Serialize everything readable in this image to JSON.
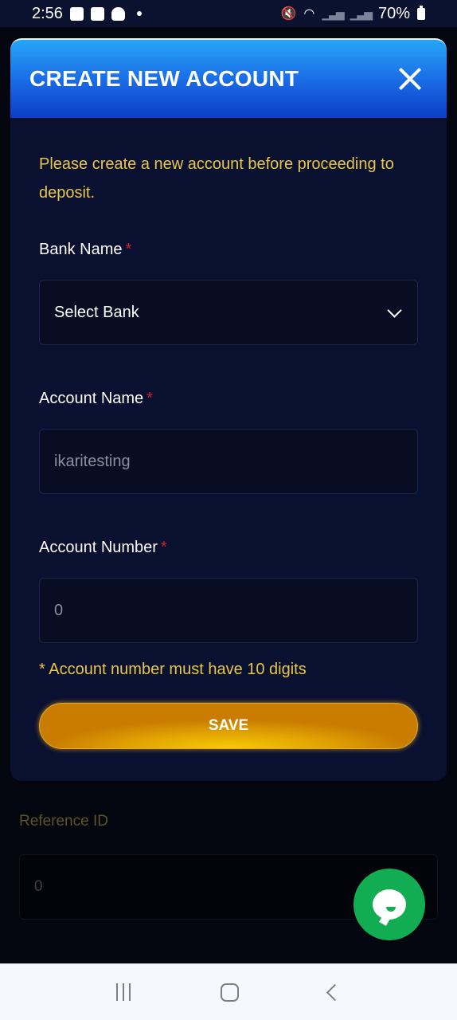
{
  "status_bar": {
    "time": "2:56",
    "notification_icons": [
      "gallery-icon",
      "checkbox-icon",
      "ghost-icon",
      "dot-icon"
    ],
    "system_icons": [
      "mute-icon",
      "wifi-icon",
      "signal-icon",
      "signal-icon"
    ],
    "battery": "70%"
  },
  "modal": {
    "title": "CREATE NEW ACCOUNT",
    "close_icon": "close-icon",
    "notice": "Please create a new account before proceeding to deposit.",
    "required_marker": "*",
    "fields": {
      "bank_name": {
        "label": "Bank Name",
        "value": "Select Bank"
      },
      "account_name": {
        "label": "Account Name",
        "value": "ikaritesting"
      },
      "account_number": {
        "label": "Account Number",
        "value": "0",
        "hint": "* Account number must have 10 digits"
      }
    },
    "save_label": "SAVE",
    "colors": {
      "header_top": "#27a6f8",
      "header_bottom": "#0b3dc9",
      "notice_text": "#e8c64a",
      "required": "#d0202e",
      "save_button": "#e0a202"
    }
  },
  "background_page": {
    "reference_label": "Reference ID",
    "reference_value": "0"
  },
  "chat_fab": {
    "icon": "chat-bubble-icon",
    "color": "#12ac52"
  },
  "nav_bar": {
    "buttons": [
      "recent-apps",
      "home",
      "back"
    ]
  }
}
